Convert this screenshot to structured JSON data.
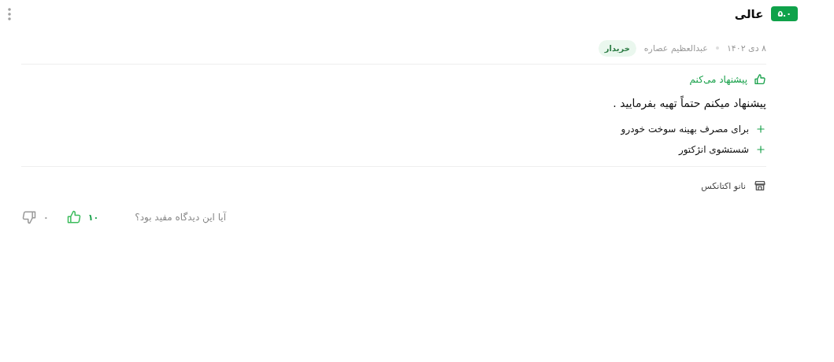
{
  "header": {
    "score": "۵.۰",
    "label": "عالی"
  },
  "meta": {
    "date": "۸ دی ۱۴۰۲",
    "author": "عبدالعظیم عصاره",
    "badge": "خریدار"
  },
  "recommendation": {
    "kind": "recommend",
    "text": "پیشنهاد می‌کنم"
  },
  "body": "پیشنهاد میکنم حتماً تهیه بفرمایید .",
  "points": [
    {
      "kind": "pro",
      "text": "برای مصرف بهینه سوخت خودرو"
    },
    {
      "kind": "pro",
      "text": "شستشوی انژکتور"
    }
  ],
  "seller": "نانو اکتانکس",
  "feedback": {
    "question": "آیا این دیدگاه مفید بود؟",
    "votes": [
      {
        "kind": "up",
        "count": "۱۰"
      },
      {
        "kind": "down",
        "count": "۰"
      }
    ]
  }
}
